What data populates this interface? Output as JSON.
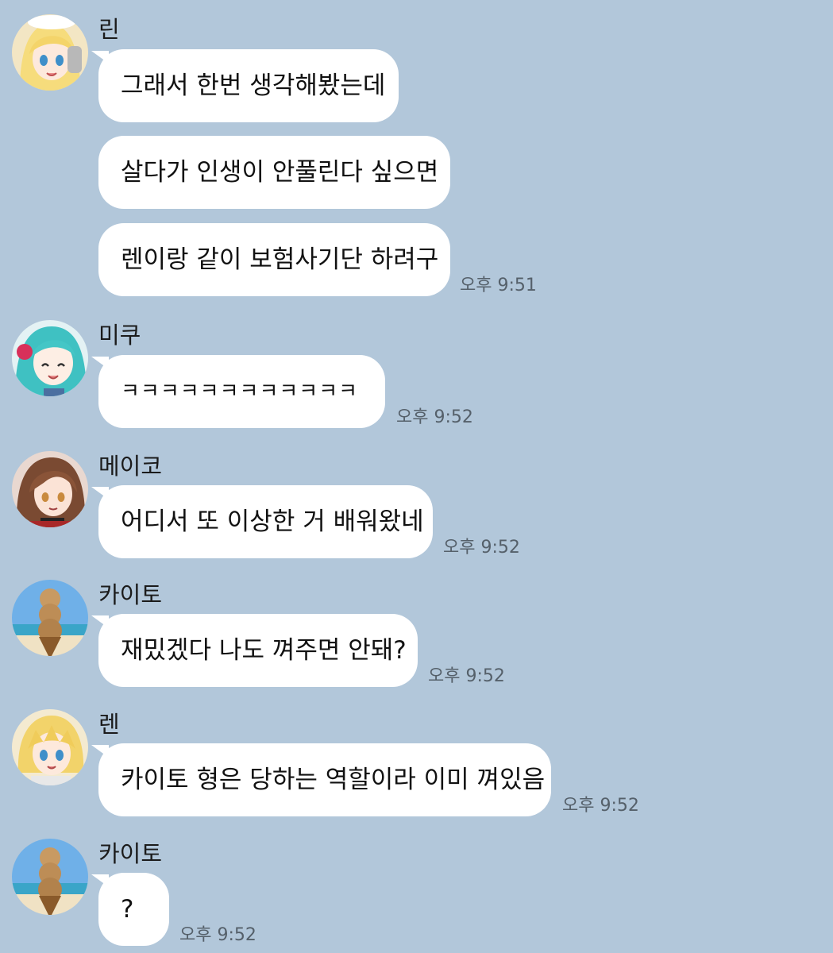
{
  "theme": {
    "background": "#b2c7da",
    "bubble": "#ffffff"
  },
  "messages": [
    {
      "sender": "린",
      "avatar_icon": "rin-avatar-icon",
      "lines": [
        "그래서 한번 생각해봤는데",
        "살다가 인생이 안풀린다 싶으면",
        "렌이랑 같이 보험사기단 하려구"
      ],
      "time": "오후 9:51"
    },
    {
      "sender": "미쿠",
      "avatar_icon": "miku-avatar-icon",
      "lines": [
        "ㅋㅋㅋㅋㅋㅋㅋㅋㅋㅋㅋㅋ"
      ],
      "time": "오후 9:52"
    },
    {
      "sender": "메이코",
      "avatar_icon": "meiko-avatar-icon",
      "lines": [
        "어디서 또 이상한 거 배워왔네"
      ],
      "time": "오후 9:52"
    },
    {
      "sender": "카이토",
      "avatar_icon": "icecream-avatar-icon",
      "lines": [
        "재밌겠다 나도 껴주면 안돼?"
      ],
      "time": "오후 9:52"
    },
    {
      "sender": "렌",
      "avatar_icon": "len-avatar-icon",
      "lines": [
        "카이토 형은 당하는 역할이라 이미 껴있음"
      ],
      "time": "오후 9:52"
    },
    {
      "sender": "카이토",
      "avatar_icon": "icecream-avatar-icon",
      "lines": [
        "?"
      ],
      "time": "오후 9:52"
    }
  ]
}
